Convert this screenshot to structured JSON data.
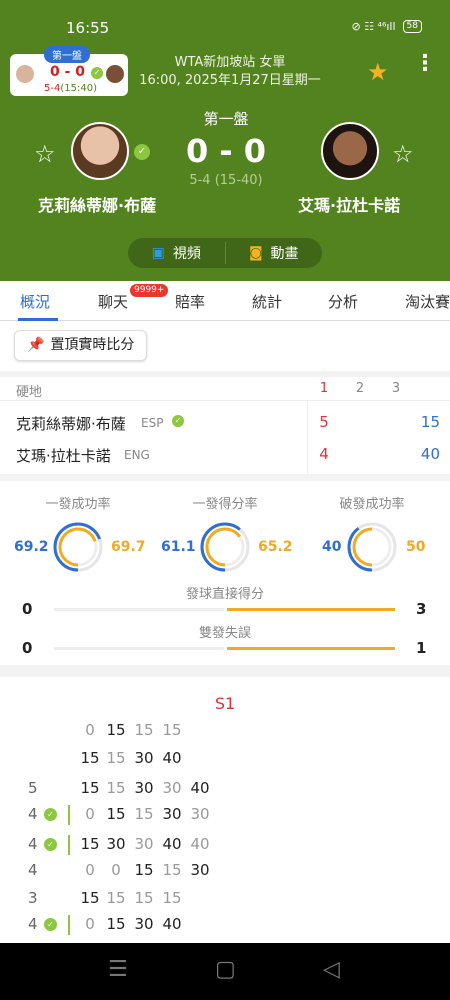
{
  "status": {
    "time": "16:55",
    "icons": "⊘ ☷ ⁴⁶ıll",
    "battery": "58"
  },
  "mini": {
    "tag": "第一盤",
    "score": "0 - 0",
    "sub_games": "5-4",
    "sub_points": "(15:40)"
  },
  "event": {
    "line1": "WTA新加坡站 女單",
    "line2": "16:00, 2025年1月27日星期一"
  },
  "match": {
    "set_label": "第一盤",
    "score": "0 - 0",
    "game_score": "5-4 (15-40)",
    "player1": "克莉絲蒂娜·布薩",
    "player2": "艾瑪·拉杜卡諾"
  },
  "media": {
    "video": "視頻",
    "anim": "動畫"
  },
  "tabs": [
    {
      "label": "概況"
    },
    {
      "label": "聊天"
    },
    {
      "label": "賠率"
    },
    {
      "label": "統計"
    },
    {
      "label": "分析"
    },
    {
      "label": "淘汰賽"
    }
  ],
  "chat_badge": "9999+",
  "pin_button": "置頂實時比分",
  "table": {
    "surface": "硬地",
    "cols": [
      "1",
      "2",
      "3"
    ],
    "rows": [
      {
        "name": "克莉絲蒂娜·布薩",
        "nat": "ESP",
        "set1": "5",
        "total": "15"
      },
      {
        "name": "艾瑪·拉杜卡諾",
        "nat": "ENG",
        "set1": "4",
        "total": "40"
      }
    ]
  },
  "stats": {
    "rings": [
      {
        "title": "一發成功率",
        "left": "69.2",
        "right": "69.7",
        "left_frac": 0.692,
        "right_frac": 0.697
      },
      {
        "title": "一發得分率",
        "left": "61.1",
        "right": "65.2",
        "left_frac": 0.611,
        "right_frac": 0.652
      },
      {
        "title": "破發成功率",
        "left": "40",
        "right": "50",
        "left_frac": 0.4,
        "right_frac": 0.5
      }
    ],
    "bars": [
      {
        "title": "發球直接得分",
        "left": "0",
        "right": "3"
      },
      {
        "title": "雙發失誤",
        "left": "0",
        "right": "1"
      }
    ]
  },
  "pbp": {
    "set": "S1",
    "groups": [
      {
        "top": {
          "g": "",
          "pts": [
            "0",
            "15",
            "15",
            "15"
          ]
        },
        "bot": {
          "g": "",
          "pts": [
            "15",
            "15",
            "30",
            "40"
          ]
        }
      },
      {
        "top": {
          "g": "5",
          "pts": [
            "15",
            "15",
            "30",
            "30",
            "40"
          ]
        },
        "bot": {
          "g": "4",
          "pts": [
            "0",
            "15",
            "15",
            "30",
            "30"
          ]
        }
      },
      {
        "top": {
          "g": "4",
          "pts": [
            "15",
            "30",
            "30",
            "40",
            "40"
          ]
        },
        "bot": {
          "g": "4",
          "pts": [
            "0",
            "0",
            "15",
            "15",
            "30"
          ]
        }
      },
      {
        "top": {
          "g": "3",
          "pts": [
            "15",
            "15",
            "15",
            "15"
          ]
        },
        "bot": {
          "g": "4",
          "pts": [
            "0",
            "15",
            "30",
            "40"
          ]
        }
      }
    ]
  },
  "colors": {
    "hero": "#53831f",
    "blue": "#2e6fd1",
    "gold": "#f3a921",
    "red": "#e0323a",
    "check": "#8dc63f"
  }
}
